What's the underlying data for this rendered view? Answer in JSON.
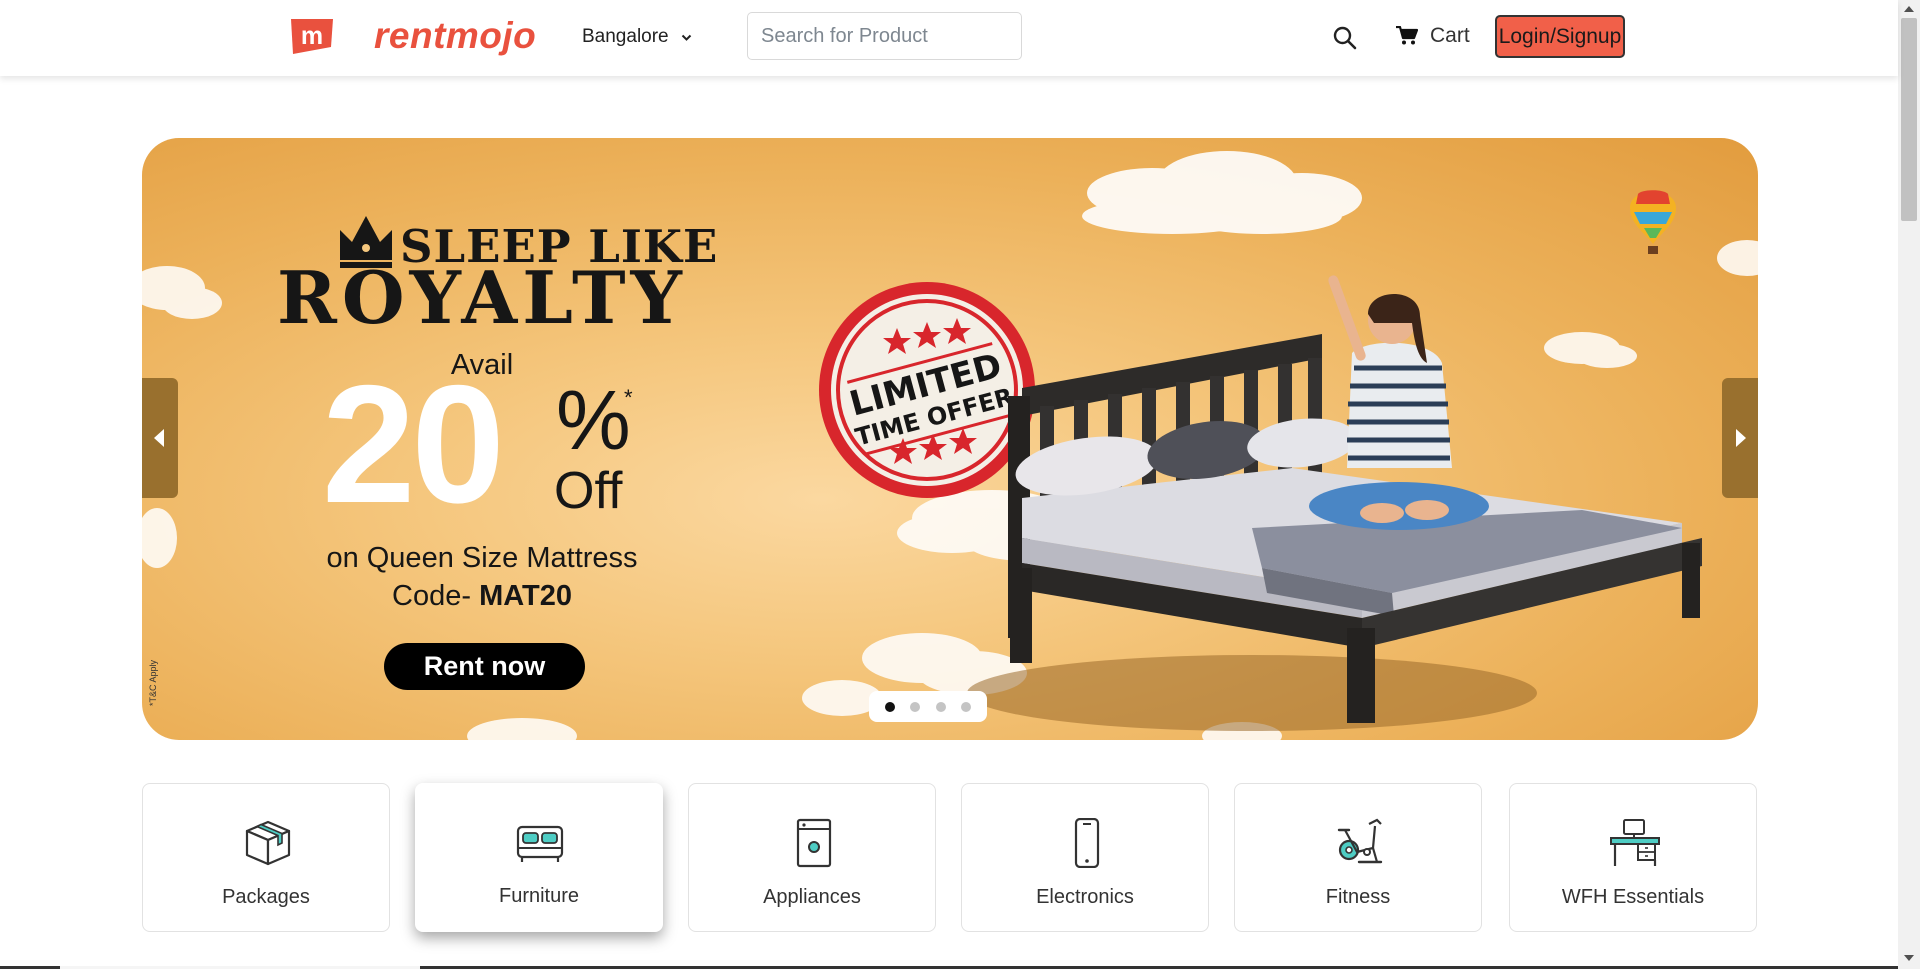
{
  "header": {
    "logo_letter": "m",
    "brand": "rentmojo",
    "city": "Bangalore",
    "search_placeholder": "Search for Product",
    "cart_label": "Cart",
    "login_label": "Login/Signup"
  },
  "banner": {
    "headline_top": "SLEEP LIKE",
    "headline_bottom": "ROYALTY",
    "avail": "Avail",
    "discount_number": "20",
    "percent_sign": "%",
    "asterisk": "*",
    "off": "Off",
    "product_line": "on Queen Size Mattress",
    "code_prefix": "Code- ",
    "code": "MAT20",
    "cta": "Rent now",
    "stamp_line1": "LIMITED",
    "stamp_line2": "TIME OFFER",
    "tnc": "*T&C Apply",
    "slide_count": 4,
    "active_slide": 1
  },
  "categories": [
    {
      "label": "Packages",
      "icon": "box-icon"
    },
    {
      "label": "Furniture",
      "icon": "bed-icon"
    },
    {
      "label": "Appliances",
      "icon": "washing-machine-icon"
    },
    {
      "label": "Electronics",
      "icon": "phone-icon"
    },
    {
      "label": "Fitness",
      "icon": "exercise-bike-icon"
    },
    {
      "label": "WFH Essentials",
      "icon": "desk-icon"
    }
  ],
  "colors": {
    "brand_red": "#e9513e",
    "login_bg": "#f16049",
    "banner_bg": "#ecb15a",
    "icon_teal": "#4ecdc4",
    "stamp_red": "#d8262c"
  }
}
